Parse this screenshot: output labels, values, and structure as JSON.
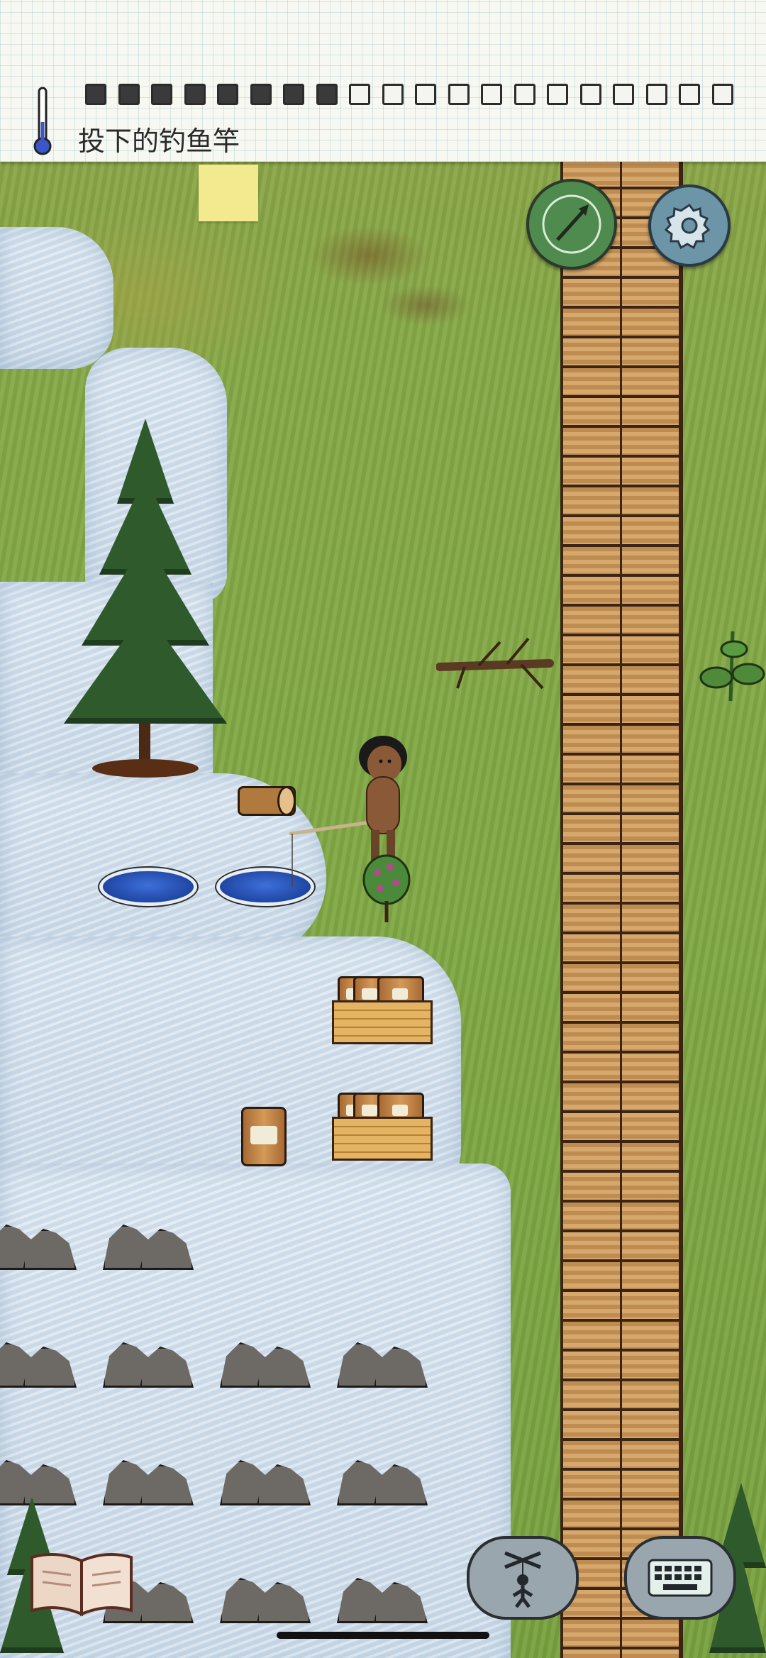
{
  "hud": {
    "hint_text": "投下的钓鱼竿",
    "food_pips": {
      "total": 20,
      "filled": 8
    },
    "temperature_icon": "thermometer-icon"
  },
  "world": {
    "objects": [
      "pine-tree",
      "fallen-branch",
      "milkweed-plant",
      "cut-log",
      "ice-hole",
      "fishing-rod",
      "berry-bush",
      "crate-of-jars",
      "jar",
      "big-rocks",
      "wooden-road"
    ]
  },
  "buttons": {
    "compass": "compass-icon",
    "settings": "gear-icon",
    "tech_book": "book-icon",
    "emote": "puppet-icon",
    "keyboard": "keyboard-icon"
  },
  "colors": {
    "grass": "#7fa844",
    "ice": "#d7e3ee",
    "road": "#c99658",
    "water_hole": "#2f5fc4",
    "compass_button": "#4f8a4f",
    "settings_button": "#6c95a8",
    "note": "#f3e98f"
  }
}
